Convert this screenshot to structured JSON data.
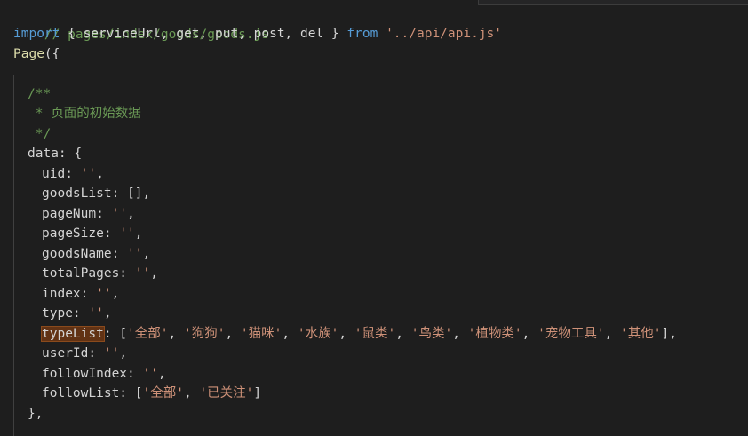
{
  "code": {
    "path_comment": "// pages/index/goods/goods.js",
    "import_kw": "import",
    "import_names": " { serviceUrl, get, put, post, del } ",
    "from_kw": "from",
    "import_path": "'../api/api.js'",
    "page_call": "Page",
    "page_open": "({",
    "doc_open": "/**",
    "doc_text": " * 页面的初始数据",
    "doc_close": " */",
    "data_key": "data: {",
    "uid_key": "uid: ",
    "uid_val": "''",
    "goodsList_key": "goodsList: [],",
    "pageNum_key": "pageNum: ",
    "pageNum_val": "''",
    "pageSize_key": "pageSize: ",
    "pageSize_val": "''",
    "goodsName_key": "goodsName: ",
    "goodsName_val": "''",
    "totalPages_key": "totalPages: ",
    "totalPages_val": "''",
    "index_key": "index: ",
    "index_val": "''",
    "type_key": "type: ",
    "type_val": "''",
    "typeList_key": "typeList",
    "typeList_mid": ": [",
    "typeList_items": [
      "'全部'",
      "'狗狗'",
      "'猫咪'",
      "'水族'",
      "'鼠类'",
      "'鸟类'",
      "'植物类'",
      "'宠物工具'",
      "'其他'"
    ],
    "typeList_end": "],",
    "userId_key": "userId: ",
    "userId_val": "''",
    "followIndex_key": "followIndex: ",
    "followIndex_val": "''",
    "followList_key": "followList: [",
    "followList_items": [
      "'全部'",
      "'已关注'"
    ],
    "followList_end": "]",
    "data_close": "},",
    "comma": ",",
    "sep": ", "
  },
  "colors": {
    "background": "#1e1e1e",
    "comment": "#6a9955",
    "keyword": "#569cd6",
    "function": "#dcdcaa",
    "string": "#ce9178",
    "highlight": "#613214"
  }
}
